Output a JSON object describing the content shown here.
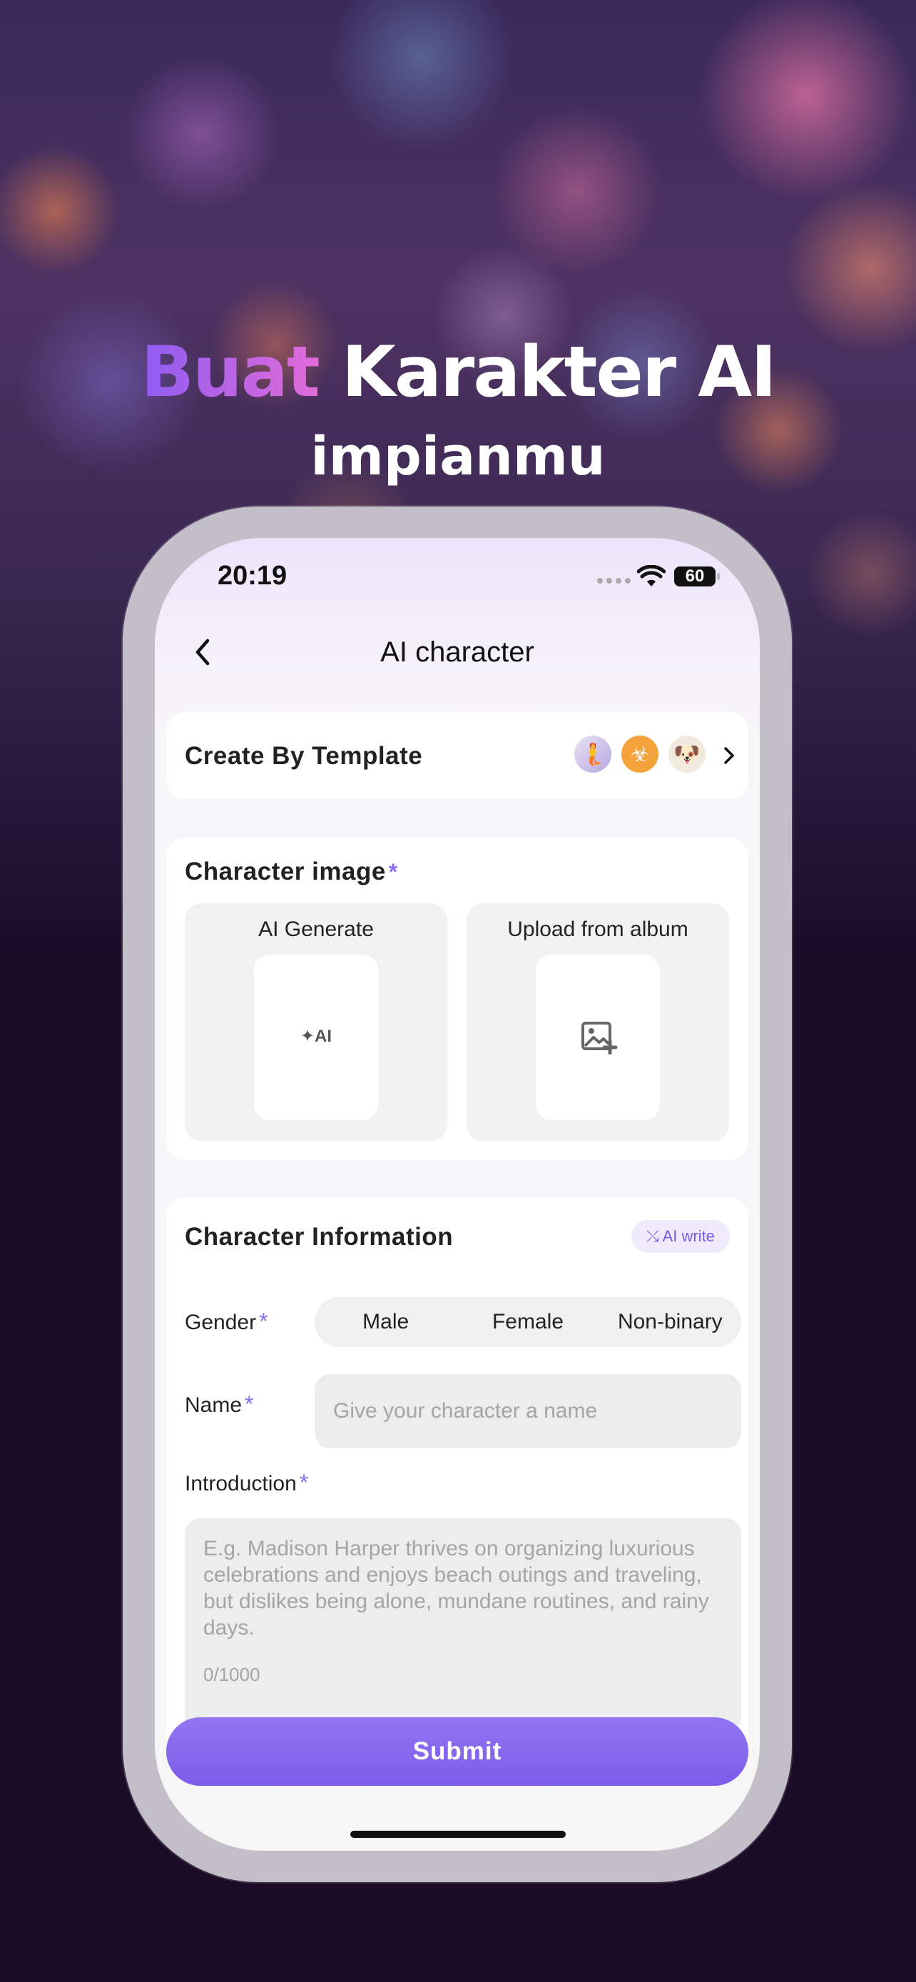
{
  "promo": {
    "title_accent": "Buat",
    "title_rest": " Karakter AI",
    "subtitle": "impianmu",
    "accent_gradient": [
      "#8f5cf2",
      "#e26bd8"
    ]
  },
  "status_bar": {
    "time": "20:19",
    "battery": "60",
    "icons": [
      "signal-dots-icon",
      "wifi-icon",
      "battery-icon"
    ]
  },
  "nav": {
    "title": "AI character",
    "back_icon": "chevron-left-icon"
  },
  "template": {
    "label": "Create By Template",
    "avatars": [
      "🧜",
      "☣",
      "🐶"
    ],
    "arrow_icon": "chevron-right-icon"
  },
  "character_image": {
    "title": "Character image",
    "required": "*",
    "options": [
      {
        "label": "AI Generate",
        "icon_text": "✦AI",
        "icon": "ai-sparkle-icon"
      },
      {
        "label": "Upload from album",
        "icon": "image-add-icon"
      }
    ]
  },
  "character_info": {
    "title": "Character Information",
    "ai_write_label": "AI write",
    "gender": {
      "label": "Gender",
      "required": "*",
      "options": [
        "Male",
        "Female",
        "Non-binary"
      ]
    },
    "name": {
      "label": "Name",
      "required": "*",
      "value": "",
      "placeholder": "Give your character a name"
    },
    "introduction": {
      "label": "Introduction",
      "required": "*",
      "value": "",
      "placeholder": "E.g. Madison Harper thrives on organizing luxurious celebrations and enjoys beach outings and traveling, but dislikes being alone, mundane routines, and rainy days.",
      "counter": "0/1000"
    }
  },
  "submit_label": "Submit",
  "colors": {
    "accent": "#8b6cf0",
    "submit": "#8368ec",
    "page_background": "#1c0b27"
  }
}
